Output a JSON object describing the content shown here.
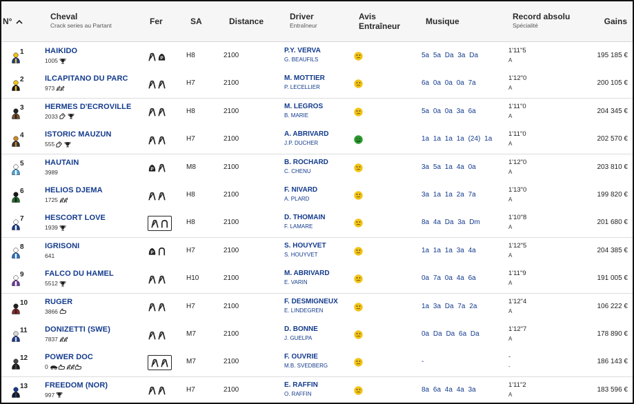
{
  "header": {
    "num": "N°",
    "cheval": "Cheval",
    "cheval_sub": "Crack series au Partant",
    "fer": "Fer",
    "sa": "SA",
    "distance": "Distance",
    "driver": "Driver",
    "driver_sub": "Entraîneur",
    "avis_1": "Avis",
    "avis_2": "Entraîneur",
    "musique": "Musique",
    "record": "Record absolu",
    "record_sub": "Spécialité",
    "gains": "Gains"
  },
  "colors": {
    "blue_link": "#123a8c",
    "smiley_yellow": "#f2c316",
    "smiley_green": "#2c9a2c",
    "header_bg": "#f6f6f6"
  },
  "rows": [
    {
      "num": "1",
      "name": "HAIKIDO",
      "sub": "1005",
      "sub_icons": [
        "trophy-icon"
      ],
      "fer": [
        "shoe-icon",
        "shoe-filled-icon"
      ],
      "fer_boxed": false,
      "sa": "H8",
      "distance": "2100",
      "driver": "P.Y. VERVA",
      "trainer": "G. BEAUFILS",
      "avis": "neutral",
      "musique": "5a  5a  Da  3a  Da",
      "record": "1'11\"5",
      "spec": "A",
      "gains": "195 185 €",
      "jockey": [
        "#1a3a8a",
        "#f2c316"
      ]
    },
    {
      "num": "2",
      "name": "ILCAPITANO DU PARC",
      "sub": "973",
      "sub_icons": [
        "horses-icon"
      ],
      "fer": [
        "shoe-icon",
        "shoe-icon"
      ],
      "fer_boxed": false,
      "sa": "H7",
      "distance": "2100",
      "driver": "M. MOTTIER",
      "trainer": "P. LECELLIER",
      "avis": "neutral",
      "musique": "6a  0a  0a  0a  7a",
      "record": "1'12\"0",
      "spec": "A",
      "gains": "200 105 €",
      "jockey": [
        "#1a1a1a",
        "#f2c316"
      ]
    },
    {
      "num": "3",
      "name": "HERMES D'ECROVILLE",
      "sub": "2033",
      "sub_icons": [
        "tag-icon",
        "trophy-icon"
      ],
      "fer": [
        "shoe-icon",
        "shoe-icon"
      ],
      "fer_boxed": false,
      "sa": "H8",
      "distance": "2100",
      "driver": "M. LEGROS",
      "trainer": "B. MARIE",
      "avis": "neutral",
      "musique": "5a  0a  0a  3a  6a",
      "record": "1'11\"0",
      "spec": "A",
      "gains": "204 345 €",
      "jockey": [
        "#7a5230",
        "#222"
      ]
    },
    {
      "num": "4",
      "name": "ISTORIC MAUZUN",
      "sub": "555",
      "sub_icons": [
        "tag-icon",
        "trophy-icon"
      ],
      "fer": [
        "shoe-icon",
        "shoe-icon"
      ],
      "fer_boxed": false,
      "sa": "H7",
      "distance": "2100",
      "driver": "A. ABRIVARD",
      "trainer": "J.P. DUCHER",
      "avis": "positive",
      "musique": "1a  1a  1a  1a  (24)  1a",
      "record": "1'11\"0",
      "spec": "A",
      "gains": "202 570 €",
      "jockey": [
        "#333",
        "#c98a2a"
      ]
    },
    {
      "num": "5",
      "name": "HAUTAIN",
      "sub": "3989",
      "sub_icons": [],
      "fer": [
        "shoe-filled-icon",
        "shoe-icon"
      ],
      "fer_boxed": false,
      "sa": "M8",
      "distance": "2100",
      "driver": "B. ROCHARD",
      "trainer": "C. CHENU",
      "avis": "neutral",
      "musique": "3a  5a  1a  4a  0a",
      "record": "1'12\"0",
      "spec": "A",
      "gains": "203 810 €",
      "jockey": [
        "#4aa3d8",
        "#ffffff"
      ]
    },
    {
      "num": "6",
      "name": "HELIOS DJEMA",
      "sub": "1725",
      "sub_icons": [
        "horses-icon"
      ],
      "fer": [
        "shoe-icon",
        "shoe-icon"
      ],
      "fer_boxed": false,
      "sa": "H8",
      "distance": "2100",
      "driver": "F. NIVARD",
      "trainer": "A. PLARD",
      "avis": "neutral",
      "musique": "3a  1a  1a  2a  7a",
      "record": "1'13\"0",
      "spec": "A",
      "gains": "199 820 €",
      "jockey": [
        "#1f6b2e",
        "#1a1a1a"
      ]
    },
    {
      "num": "7",
      "name": "HESCORT LOVE",
      "sub": "1939",
      "sub_icons": [
        "trophy-icon"
      ],
      "fer": [
        "shoe-icon",
        "horseshoe-open-icon"
      ],
      "fer_boxed": true,
      "sa": "H8",
      "distance": "2100",
      "driver": "D. THOMAIN",
      "trainer": "F. LAMARE",
      "avis": "neutral",
      "musique": "8a  4a  Da  3a  Dm",
      "record": "1'10\"8",
      "spec": "A",
      "gains": "201 680 €",
      "jockey": [
        "#1a3a8a",
        "#ffffff"
      ]
    },
    {
      "num": "8",
      "name": "IGRISONI",
      "sub": "641",
      "sub_icons": [],
      "fer": [
        "shoe-filled-icon",
        "horseshoe-open-icon"
      ],
      "fer_boxed": false,
      "sa": "H7",
      "distance": "2100",
      "driver": "S. HOUYVET",
      "trainer": "S. HOUYVET",
      "avis": "neutral",
      "musique": "1a  1a  1a  3a  4a",
      "record": "1'12\"5",
      "spec": "A",
      "gains": "204 385 €",
      "jockey": [
        "#2a6fc0",
        "#ffffff"
      ]
    },
    {
      "num": "9",
      "name": "FALCO DU HAMEL",
      "sub": "5512",
      "sub_icons": [
        "trophy-icon"
      ],
      "fer": [
        "shoe-icon",
        "shoe-icon"
      ],
      "fer_boxed": false,
      "sa": "H10",
      "distance": "2100",
      "driver": "M. ABRIVARD",
      "trainer": "E. VARIN",
      "avis": "neutral",
      "musique": "0a  7a  0a  4a  6a",
      "record": "1'11\"9",
      "spec": "A",
      "gains": "191 005 €",
      "jockey": [
        "#6a3a9a",
        "#ffffff"
      ]
    },
    {
      "num": "10",
      "name": "RUGER",
      "sub": "3866",
      "sub_icons": [
        "hand-icon"
      ],
      "fer": [
        "shoe-icon",
        "shoe-icon"
      ],
      "fer_boxed": false,
      "sa": "H7",
      "distance": "2100",
      "driver": "F. DESMIGNEUX",
      "trainer": "E. LINDEGREN",
      "avis": "neutral",
      "musique": "1a  3a  Da  7a  2a",
      "record": "1'12\"4",
      "spec": "A",
      "gains": "106 222 €",
      "jockey": [
        "#8a2a2a",
        "#222"
      ]
    },
    {
      "num": "11",
      "name": "DONIZETTI (SWE)",
      "sub": "7837",
      "sub_icons": [
        "horses-icon"
      ],
      "fer": [
        "shoe-icon",
        "shoe-icon"
      ],
      "fer_boxed": false,
      "sa": "M7",
      "distance": "2100",
      "driver": "D. BONNE",
      "trainer": "J. GUELPA",
      "avis": "neutral",
      "musique": "0a  Da  Da  6a  Da",
      "record": "1'12\"7",
      "spec": "A",
      "gains": "178 890 €",
      "jockey": [
        "#1a3a8a",
        "#d8d8d8"
      ]
    },
    {
      "num": "12",
      "name": "POWER DOC",
      "sub": "0",
      "sub_icons": [
        "car-icon",
        "hand-icon",
        "horses-icon",
        "hand-icon"
      ],
      "fer": [
        "shoe-icon",
        "shoe-icon"
      ],
      "fer_boxed": true,
      "sa": "M7",
      "distance": "2100",
      "driver": "F. OUVRIE",
      "trainer": "M.B. SVEDBERG",
      "avis": "neutral",
      "musique": "-",
      "record": "-",
      "spec": "-",
      "gains": "186 143 €",
      "jockey": [
        "#1a1a1a",
        "#444"
      ]
    },
    {
      "num": "13",
      "name": "FREEDOM (NOR)",
      "sub": "997",
      "sub_icons": [
        "trophy-icon"
      ],
      "fer": [
        "shoe-icon",
        "shoe-icon"
      ],
      "fer_boxed": false,
      "sa": "H7",
      "distance": "2100",
      "driver": "E. RAFFIN",
      "trainer": "O. RAFFIN",
      "avis": "neutral",
      "musique": "8a  6a  4a  4a  3a",
      "record": "1'11\"2",
      "spec": "A",
      "gains": "183 596 €",
      "jockey": [
        "#1a1a1a",
        "#1a3a8a"
      ]
    }
  ]
}
